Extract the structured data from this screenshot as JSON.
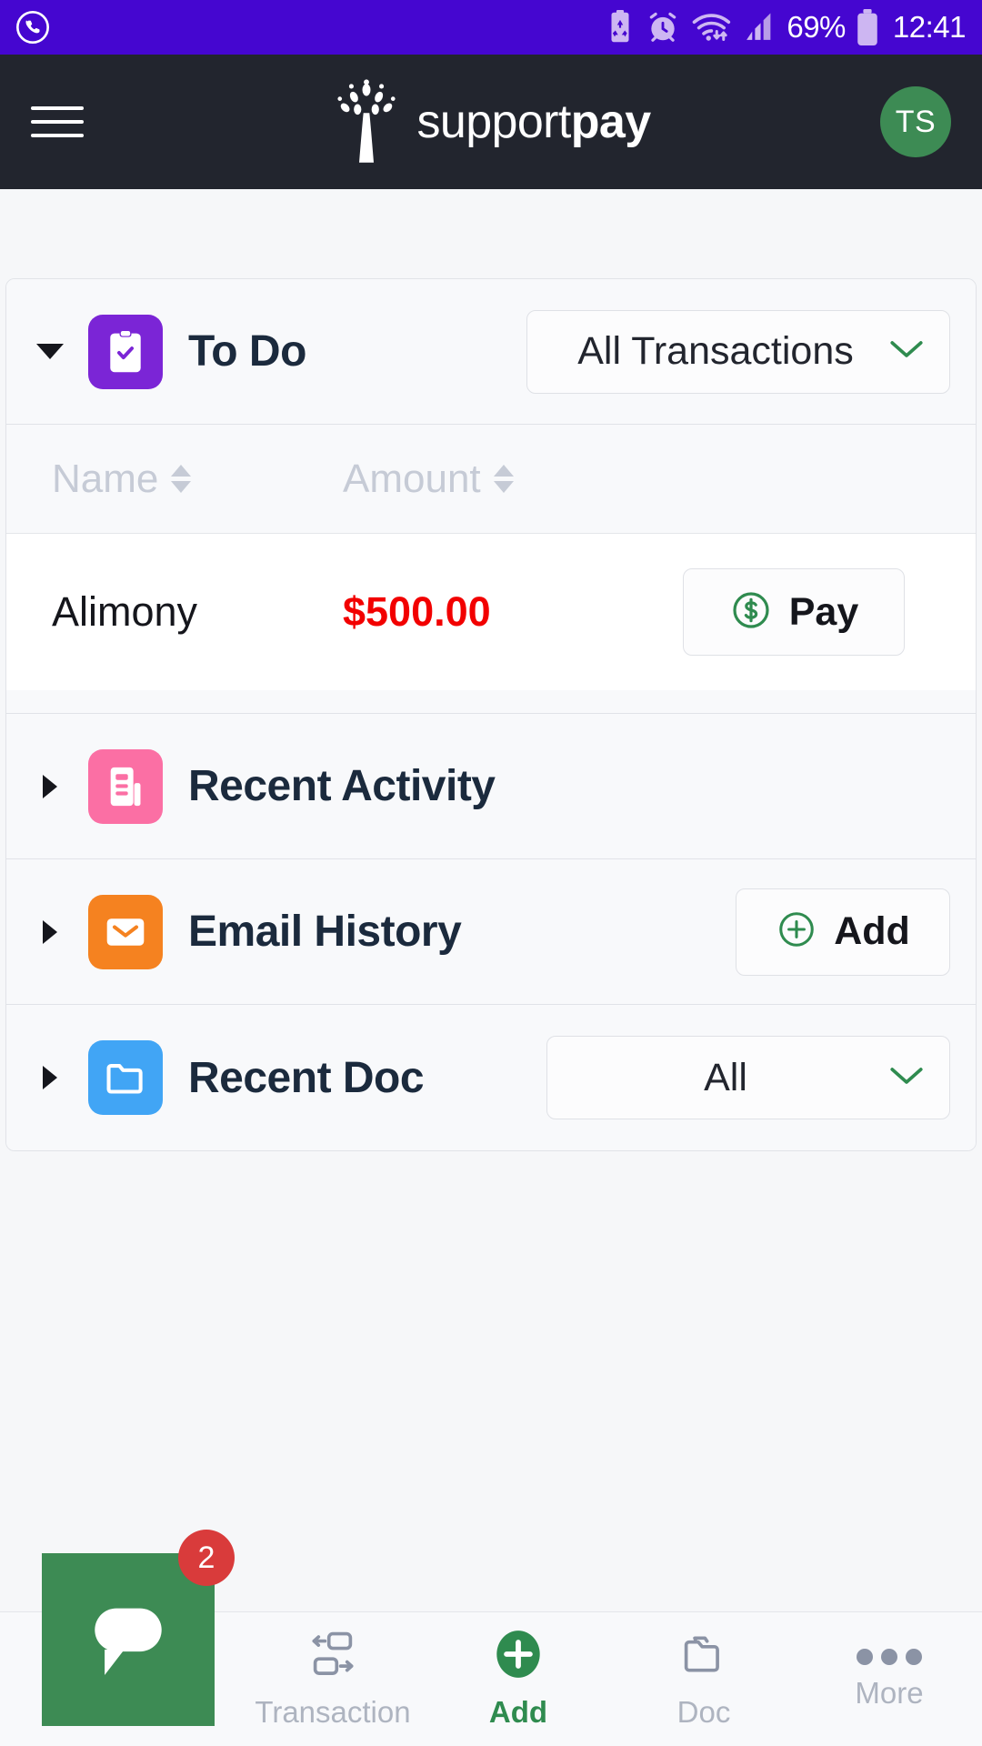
{
  "status_bar": {
    "left_icons": [
      "whatsapp-icon"
    ],
    "right_icons": [
      "recycle-battery-icon",
      "alarm-icon",
      "wifi-icon",
      "signal-icon"
    ],
    "battery_percent": "69%",
    "time": "12:41",
    "bg_color": "#4506d0"
  },
  "header": {
    "menu_icon": "hamburger-menu-icon",
    "logo_icon": "tree-logo-icon",
    "brand_first": "support",
    "brand_second": "pay",
    "avatar_initials": "TS",
    "avatar_color": "#3d8b54",
    "bg_color": "#22252e"
  },
  "sections": {
    "todo": {
      "title": "To Do",
      "icon": "clipboard-check-icon",
      "icon_color": "#7b25d6",
      "expanded": true,
      "filter_value": "All Transactions",
      "columns": [
        "Name",
        "Amount"
      ],
      "rows": [
        {
          "name": "Alimony",
          "amount": "$500.00",
          "amount_color": "#f20000",
          "action": "Pay",
          "action_icon": "dollar-circle-icon"
        }
      ]
    },
    "recent_activity": {
      "title": "Recent Activity",
      "icon": "activity-report-icon",
      "icon_color": "#fb6fa4",
      "expanded": false
    },
    "email_history": {
      "title": "Email History",
      "icon": "envelope-icon",
      "icon_color": "#f58220",
      "expanded": false,
      "action": "Add",
      "action_icon": "plus-circle-icon"
    },
    "recent_doc": {
      "title": "Recent Doc",
      "icon": "folder-icon",
      "icon_color": "#41a5f5",
      "expanded": false,
      "filter_value": "All"
    }
  },
  "bottom_nav": {
    "items": [
      {
        "label": "Transaction",
        "icon": "transfer-arrows-icon",
        "active": false
      },
      {
        "label": "Add",
        "icon": "plus-circle-icon",
        "active": true
      },
      {
        "label": "Doc",
        "icon": "folder-icon",
        "active": false
      },
      {
        "label": "More",
        "icon": "ellipsis-icon",
        "active": false
      }
    ],
    "active_color": "#2f8b4f",
    "inactive_color": "#aeb4c0"
  },
  "chat_widget": {
    "icon": "chat-bubble-icon",
    "badge_count": "2",
    "bg_color": "#3d8b54",
    "badge_color": "#d93b3b"
  }
}
